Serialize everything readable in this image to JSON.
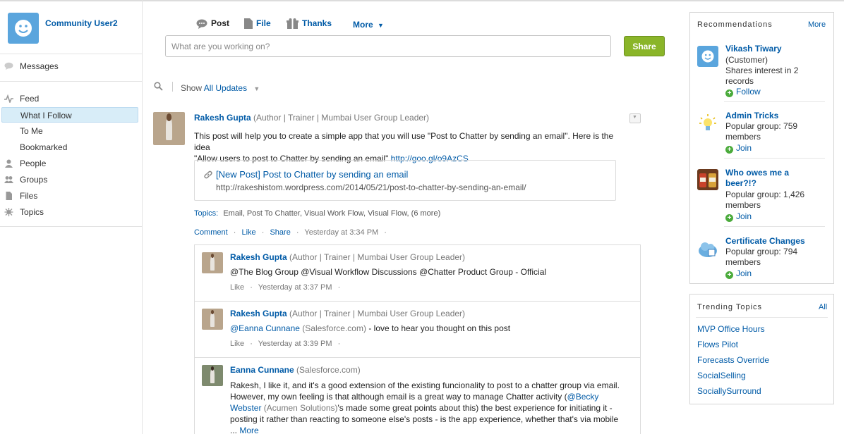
{
  "user": {
    "name": "Community User2"
  },
  "nav": {
    "messages": "Messages",
    "feed": "Feed",
    "what_i_follow": "What I Follow",
    "to_me": "To Me",
    "bookmarked": "Bookmarked",
    "people": "People",
    "groups": "Groups",
    "files": "Files",
    "topics": "Topics"
  },
  "publisher": {
    "tabs": {
      "post": "Post",
      "file": "File",
      "thanks": "Thanks",
      "more": "More"
    },
    "placeholder": "What are you working on?",
    "share": "Share"
  },
  "filter": {
    "show": "Show",
    "value": "All Updates"
  },
  "post": {
    "author": "Rakesh Gupta",
    "role": "(Author | Trainer | Mumbai User Group Leader)",
    "text1": "This post will help you to create a simple app that you will use \"Post to Chatter by sending an email\". Here is the idea",
    "text2": "\"Allow users to post to Chatter by sending an email\"",
    "url": "http://goo.gl/o9AzCS",
    "link_title": "[New Post] Post to Chatter by sending an email",
    "link_url": "http://rakeshistom.wordpress.com/2014/05/21/post-to-chatter-by-sending-an-email/",
    "topics_label": "Topics:",
    "topics": "Email, Post To Chatter, Visual Work Flow, Visual Flow, (6 more)",
    "comment": "Comment",
    "like": "Like",
    "share": "Share",
    "time": "Yesterday at 3:34 PM"
  },
  "comments": [
    {
      "author": "Rakesh Gupta",
      "role": "(Author | Trainer | Mumbai User Group Leader)",
      "text": "@The Blog Group @Visual Workflow Discussions @Chatter Product Group - Official",
      "like": "Like",
      "time": "Yesterday at 3:37 PM"
    },
    {
      "author": "Rakesh Gupta",
      "role": "(Author | Trainer | Mumbai User Group Leader)",
      "mention": "@Eanna Cunnane",
      "org": "(Salesforce.com)",
      "text": " - love to hear you thought on this post",
      "like": "Like",
      "time": "Yesterday at 3:39 PM"
    },
    {
      "author": "Eanna Cunnane",
      "role": "(Salesforce.com)",
      "line1": "Rakesh, I like it, and it's a good extension of the existing funcionality to post to a chatter group via email.",
      "line2a": "However, my own feeling is that although email is a great way to manage Chatter activity (",
      "line2b": "@Becky",
      "line3a": "Webster",
      "line3b": " (Acumen Solutions)",
      "line3c": "'s made some great points about this) the best experience for initiating it -",
      "line4": "posting it rather than reacting to someone else's posts - is the app experience, whether that's via mobile",
      "ellipsis": "... ",
      "more": "More"
    }
  ],
  "recommendations": {
    "title": "Recommendations",
    "more": "More",
    "items": [
      {
        "name": "Vikash Tiwary",
        "line1": "(Customer)",
        "line2": "Shares interest in 2",
        "line3": "records",
        "action": "Follow"
      },
      {
        "name": "Admin Tricks",
        "line1": "Popular group: 759",
        "line2": "members",
        "action": "Join"
      },
      {
        "name": "Who owes me a",
        "name2": "beer?!?",
        "line1": "Popular group: 1,426",
        "line2": "members",
        "action": "Join"
      },
      {
        "name": "Certificate Changes",
        "line1": "Popular group: 794",
        "line2": "members",
        "action": "Join"
      }
    ]
  },
  "trending": {
    "title": "Trending Topics",
    "all": "All",
    "items": [
      "MVP Office Hours",
      "Flows Pilot",
      "Forecasts Override",
      "SocialSelling",
      "SociallySurround"
    ]
  },
  "colors": {
    "link": "#015ba7",
    "share_button": "#8ab529",
    "selected_nav": "#d8edf8"
  }
}
